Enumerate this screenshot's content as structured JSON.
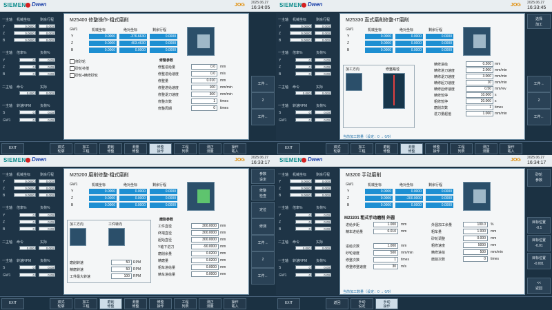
{
  "header": {
    "brand": "SIEMENS",
    "logo": "Dwen",
    "mode": "JOG",
    "q1": {
      "date": "2025.06.27",
      "time": "16:34:05"
    },
    "q2": {
      "date": "2025.06.27",
      "time": "16:33:45"
    },
    "q3": {
      "date": "2025.06.27",
      "time": "16:33:17"
    },
    "q4": {
      "date": "2025.06.27",
      "time": "16:34:17"
    }
  },
  "left": {
    "hdr1": "一主轴",
    "hdr2": "机械坐标",
    "hdr3": "剩余行程",
    "axes": [
      "Y",
      "Z",
      "B"
    ],
    "q1_vals": [
      [
        "0.0000",
        "0.000"
      ],
      [
        "0.0000",
        "0.000"
      ],
      [
        "0.0000",
        "0.000"
      ]
    ],
    "q2_vals": [
      [
        "0.0000",
        "0.000"
      ],
      [
        "0.0000",
        "0.000"
      ],
      [
        "0.0000",
        "0.000"
      ]
    ],
    "q3_vals": [
      [
        "0.0000",
        "0.000"
      ],
      [
        "0.0000",
        "0.000"
      ],
      [
        "0.0000",
        "0.000"
      ]
    ],
    "q4_vals": [
      [
        "0.0000",
        "0.000"
      ],
      [
        "0.0000",
        "0.000"
      ],
      [
        "0.0000",
        "0.000"
      ]
    ],
    "hdr4": "一主轴",
    "hdr5": "倍率%",
    "hdr6": "负荷%",
    "sp_axes": [
      "Y",
      "Z",
      "B"
    ],
    "sp_vals": [
      "0",
      "0",
      "0"
    ],
    "sp_load": [
      "0.00",
      "0.00",
      "0.00"
    ],
    "hdr7": "二主轴",
    "hdr8": "命令",
    "hdr9": "实际",
    "sp2_cmd": "0.000",
    "sp2_act": "0.000",
    "hdr10": "一主轴",
    "hdr11": "转速RPM",
    "hdr12": "负荷%",
    "s_label": "S",
    "s_val": "0",
    "s_load": "0.00",
    "gw_label": "GW1",
    "gw_val": "0",
    "gw_load": "0.00"
  },
  "q1": {
    "title": "M25400 修整操作-粗式磨削",
    "col_gw": "GW1",
    "col1": "机械坐标",
    "col2": "绝对坐标",
    "col3": "剩余行程",
    "rows": [
      [
        "Y",
        "0.0000",
        "-376.6630",
        "0.0000"
      ],
      [
        "Z",
        "0.0000",
        "403.4630",
        "0.0000"
      ],
      [
        "B",
        "0.0000",
        "0.0000",
        "0.0000"
      ]
    ],
    "checks": [
      "修砂轮",
      "砂轮补偿",
      "砂轮+精修砂轮"
    ],
    "params_title": "修整参数",
    "params": [
      [
        "修整进给量",
        "0.0",
        "mm"
      ],
      [
        "修整进给速度",
        "0.0",
        "m/s"
      ],
      [
        "修整量",
        "0.010",
        "mm"
      ],
      [
        "修整进给速度",
        "100",
        "mm/min"
      ],
      [
        "修整退刀速度",
        "300",
        "mm/min"
      ],
      [
        "修整次数",
        "1",
        "times"
      ],
      [
        "修整周期",
        "0",
        "times"
      ]
    ],
    "side_tabs": [
      "工件→",
      "2",
      "工件←"
    ],
    "buttons": [
      "EXIT",
      "双式\n轮廓",
      "加工\n工程",
      "磨削\n修整",
      "测量\n修整",
      "修整\n操作",
      "工程\n列表",
      "测正\n测量",
      "操作\n载入"
    ]
  },
  "q2": {
    "title": "M25330 直式磨削修整-IT磨削",
    "col_gw": "GW1",
    "col1": "机械坐标",
    "col2": "绝对坐标",
    "col3": "剩余行程",
    "rows": [
      [
        "Y",
        "0.0000",
        "0.0000",
        "0.0000"
      ],
      [
        "Z",
        "0.0000",
        "0.0000",
        "0.0000"
      ],
      [
        "B",
        "0.0000",
        "0.0000",
        "0.0000"
      ]
    ],
    "sub1": "加工方向",
    "sub2": "修整路径",
    "params": [
      [
        "精修进给",
        "0.200",
        "mm"
      ],
      [
        "精修进刀速度",
        "2.000",
        "mm/min"
      ],
      [
        "精修退刀速度",
        "3.000",
        "mm/min"
      ],
      [
        "精修起刀速度",
        "10",
        "mm/min"
      ],
      [
        "精修后修速度",
        "0.50",
        "mm/rev"
      ],
      [
        "精修暂停",
        "10.000",
        "s"
      ],
      [
        "粗修暂停",
        "20.000",
        "s"
      ],
      [
        "磨削次数",
        "1",
        "times"
      ],
      [
        "进刀量超值",
        "1.060",
        "mm/min"
      ]
    ],
    "side_top": "选择\n加工",
    "side_tabs": [
      "工件→",
      "2",
      "工件←"
    ],
    "status": "当前加工数量（设定：0 → 0/0）",
    "buttons": [
      "EXIT",
      "双式\n轮廓",
      "加工\n工程",
      "磨削\n修整",
      "测量\n修整",
      "修整\n操作",
      "工程\n列表",
      "测正\n测量",
      "操作\n载入"
    ]
  },
  "q3": {
    "title": "M25200 磨削修整-粗式磨削",
    "col_gw": "GW1",
    "col1": "机械坐标",
    "col2": "绝对坐标",
    "col3": "剩余行程",
    "rows": [
      [
        "Y",
        "0.0000",
        "0.0000",
        "0.0000"
      ],
      [
        "Z",
        "0.0000",
        "0.0000",
        "0.0000"
      ],
      [
        "B",
        "0.0000",
        "0.0000",
        "0.0000"
      ]
    ],
    "sub1": "加工方向",
    "sub2": "工件转向",
    "speeds": [
      [
        "磨削转速",
        "50",
        "RPM"
      ],
      [
        "精磨转速",
        "50",
        "RPM"
      ],
      [
        "工件最大转速",
        "100",
        "RPM"
      ]
    ],
    "params_title": "磨削参数",
    "params": [
      [
        "工件直径",
        "300.0000",
        "mm"
      ],
      [
        "终端直径",
        "300.0000",
        "mm"
      ],
      [
        "起始直径",
        "300.0000",
        "mm"
      ],
      [
        "Y轴下进刀",
        "-90.0000",
        "mm"
      ],
      [
        "磨削余量",
        "0.0200",
        "mm"
      ],
      [
        "精磨量",
        "0.0200",
        "mm"
      ],
      [
        "粗车进给量",
        "0.0000",
        "mm"
      ],
      [
        "精车进给量",
        "0.0000",
        "mm"
      ]
    ],
    "side_tabs": [
      "参数\n设定",
      "修整\n检查",
      "定位",
      "修测",
      "工件→",
      "2",
      "工件←"
    ],
    "buttons": [
      "EXIT",
      "双式\n轮廓",
      "加工\n工程",
      "磨削\n修整",
      "测量\n修整",
      "修整\n操作",
      "工程\n列表",
      "测正\n测量",
      "操作\n载入"
    ]
  },
  "q4": {
    "title": "M3200 手动磨削",
    "col_gw": "GW1",
    "col1": "机械坐标",
    "col2": "绝对坐标",
    "col3": "剩余行程",
    "rows": [
      [
        "Y",
        "0.0000",
        "0.0000",
        "0.0000"
      ],
      [
        "Z",
        "0.0000",
        "-200.0000",
        "0.0000"
      ],
      [
        "B",
        "0.0000",
        "0.0000",
        "0.0000"
      ]
    ],
    "sub_title": "M23201 粗式手动磨削 外圆",
    "left_params": [
      [
        "进给步距",
        "1.000",
        "mm"
      ],
      [
        "精车进给量",
        "0.010",
        "mm"
      ],
      [
        "进给次数",
        "1.000",
        "mm"
      ],
      [
        "砂轮速度",
        "500",
        "mm/min"
      ],
      [
        "修整次数",
        "1",
        "times"
      ],
      [
        "修整修整速度",
        "30",
        "m/s"
      ]
    ],
    "right_params": [
      [
        "外圆加工余量",
        "100.0",
        "%"
      ],
      [
        "粗车量",
        "1.000",
        "mm"
      ],
      [
        "砂轮调整",
        "0.000",
        "mm"
      ],
      [
        "粗修速度",
        "5000",
        "mm"
      ],
      [
        "精修进给",
        "500",
        "mm/min"
      ],
      [
        "磨削次数",
        "0",
        "times"
      ]
    ],
    "side_tabs": [
      "砂轮\n参数",
      "目标位置\n-0.1",
      "目标位置\n-0.01",
      "目标位置\n-0.001",
      "<<\n返回"
    ],
    "status": "当前加工数量（设定：0 → 0/0）",
    "buttons": [
      "EXIT",
      "返回",
      "手动\n设定",
      "手动\n操作"
    ]
  }
}
